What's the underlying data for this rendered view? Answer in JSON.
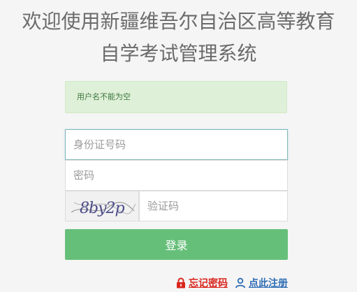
{
  "header": {
    "title_line1": "欢迎使用新疆维吾尔自治区高等教育",
    "title_line2": "自学考试管理系统"
  },
  "alert": {
    "message": "用户名不能为空"
  },
  "form": {
    "id_placeholder": "身份证号码",
    "password_placeholder": "密码",
    "captcha_text": "8by2p",
    "captcha_placeholder": "验证码",
    "login_label": "登录"
  },
  "links": {
    "forgot_password": "忘记密码",
    "register": "点此注册"
  },
  "colors": {
    "alert_bg": "#dff0d8",
    "alert_text": "#3c763d",
    "login_button": "#66bf79",
    "forgot_link": "#d9251d",
    "register_link": "#2f6db5"
  },
  "icons": {
    "forgot": "lock-icon",
    "register": "user-icon"
  }
}
